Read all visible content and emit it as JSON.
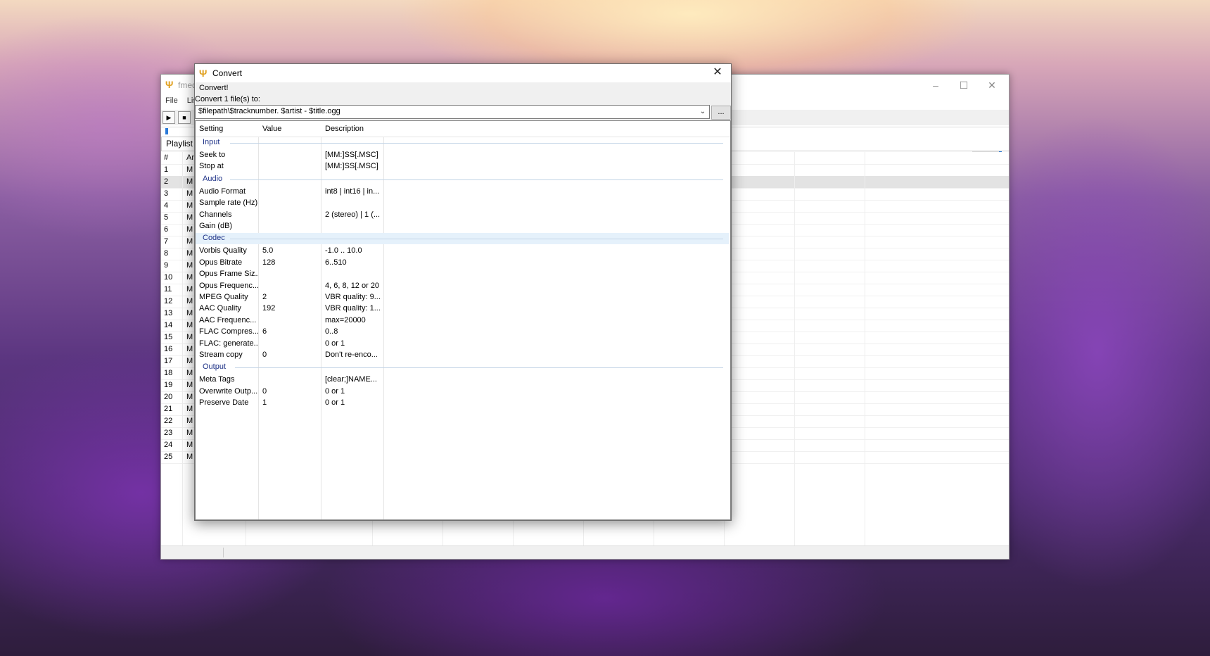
{
  "main_window": {
    "title": "fmed",
    "menu": [
      "File",
      "Lis"
    ],
    "tab": "Playlist",
    "list_header": {
      "num": "#",
      "artist": "Ar"
    },
    "rows": [
      {
        "num": "1",
        "artist": "M"
      },
      {
        "num": "2",
        "artist": "M"
      },
      {
        "num": "3",
        "artist": "M"
      },
      {
        "num": "4",
        "artist": "M"
      },
      {
        "num": "5",
        "artist": "M"
      },
      {
        "num": "6",
        "artist": "M"
      },
      {
        "num": "7",
        "artist": "M"
      },
      {
        "num": "8",
        "artist": "M"
      },
      {
        "num": "9",
        "artist": "M"
      },
      {
        "num": "10",
        "artist": "M"
      },
      {
        "num": "11",
        "artist": "M"
      },
      {
        "num": "12",
        "artist": "M"
      },
      {
        "num": "13",
        "artist": "M"
      },
      {
        "num": "14",
        "artist": "M"
      },
      {
        "num": "15",
        "artist": "M"
      },
      {
        "num": "16",
        "artist": "M"
      },
      {
        "num": "17",
        "artist": "M"
      },
      {
        "num": "18",
        "artist": "M"
      },
      {
        "num": "19",
        "artist": "M"
      },
      {
        "num": "20",
        "artist": "M"
      },
      {
        "num": "21",
        "artist": "M"
      },
      {
        "num": "22",
        "artist": "M"
      },
      {
        "num": "23",
        "artist": "M"
      },
      {
        "num": "24",
        "artist": "M"
      },
      {
        "num": "25",
        "artist": "M"
      }
    ],
    "selected_row": "2",
    "play_icon": "play-icon",
    "stop_icon": "stop-icon"
  },
  "dialog": {
    "title": "Convert",
    "menu": "Convert!",
    "label": "Convert 1 file(s) to:",
    "path_value": "$filepath\\$tracknumber. $artist - $title.ogg",
    "browse_label": "...",
    "columns": [
      "Setting",
      "Value",
      "Description"
    ],
    "groups": [
      {
        "name": "Input",
        "rows": [
          {
            "setting": "Seek to",
            "value": "",
            "description": "[MM:]SS[.MSC]"
          },
          {
            "setting": "Stop at",
            "value": "",
            "description": "[MM:]SS[.MSC]"
          }
        ]
      },
      {
        "name": "Audio",
        "rows": [
          {
            "setting": "Audio Format",
            "value": "",
            "description": "int8 | int16 | in..."
          },
          {
            "setting": "Sample rate (Hz)",
            "value": "",
            "description": ""
          },
          {
            "setting": "Channels",
            "value": "",
            "description": "2 (stereo) | 1 (..."
          },
          {
            "setting": "Gain (dB)",
            "value": "",
            "description": ""
          }
        ]
      },
      {
        "name": "Codec",
        "rows": [
          {
            "setting": "Vorbis Quality",
            "value": "5.0",
            "description": "-1.0 .. 10.0"
          },
          {
            "setting": "Opus Bitrate",
            "value": "128",
            "description": "6..510"
          },
          {
            "setting": "Opus Frame Siz...",
            "value": "",
            "description": ""
          },
          {
            "setting": "Opus Frequenc...",
            "value": "",
            "description": "4, 6, 8, 12 or 20"
          },
          {
            "setting": "MPEG Quality",
            "value": "2",
            "description": "VBR quality: 9...."
          },
          {
            "setting": "AAC Quality",
            "value": "192",
            "description": "VBR quality: 1...."
          },
          {
            "setting": "AAC Frequenc...",
            "value": "",
            "description": "max=20000"
          },
          {
            "setting": "FLAC Compres...",
            "value": "6",
            "description": "0..8"
          },
          {
            "setting": "FLAC: generate...",
            "value": "",
            "description": "0 or 1"
          },
          {
            "setting": "Stream copy",
            "value": "0",
            "description": "Don't re-enco..."
          }
        ]
      },
      {
        "name": "Output",
        "rows": [
          {
            "setting": "Meta Tags",
            "value": "",
            "description": "[clear;]NAME..."
          },
          {
            "setting": "Overwrite Outp...",
            "value": "0",
            "description": "0 or 1"
          },
          {
            "setting": "Preserve Date",
            "value": "1",
            "description": "0 or 1"
          }
        ]
      }
    ],
    "highlighted_group": "Codec"
  },
  "colors": {
    "group_label": "#1e3287",
    "selection": "#e5f1fb",
    "accent": "#2a7ad8",
    "app_icon": "#e0a020"
  }
}
